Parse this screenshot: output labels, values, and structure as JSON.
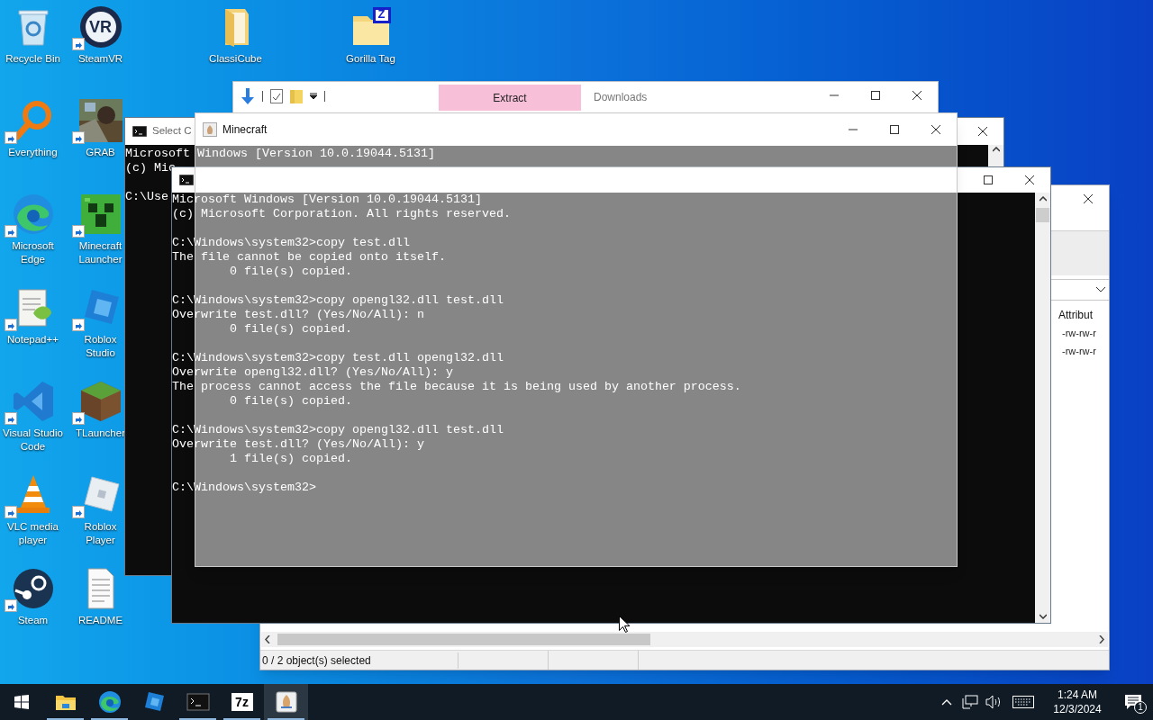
{
  "desktop_icons": [
    {
      "label": "Recycle Bin",
      "shortcut": false
    },
    {
      "label": "SteamVR",
      "shortcut": true,
      "logo_text": "VR"
    },
    {
      "label": "ClassiCube",
      "shortcut": false
    },
    {
      "label": "Gorilla Tag",
      "shortcut": false,
      "logo_text": "Z"
    },
    {
      "label": "Everything",
      "shortcut": true
    },
    {
      "label": "GRAB",
      "shortcut": true
    },
    {
      "label": "Microsoft Edge",
      "shortcut": true
    },
    {
      "label": "Minecraft Launcher",
      "shortcut": true
    },
    {
      "label": "Notepad++",
      "shortcut": true
    },
    {
      "label": "Roblox Studio",
      "shortcut": true
    },
    {
      "label": "Visual Studio Code",
      "shortcut": true
    },
    {
      "label": "TLauncher",
      "shortcut": true
    },
    {
      "label": "VLC media player",
      "shortcut": true
    },
    {
      "label": "Roblox Player",
      "shortcut": true
    },
    {
      "label": "Steam",
      "shortcut": true
    },
    {
      "label": "README",
      "shortcut": false
    }
  ],
  "file_manager": {
    "column_header": "Attribut",
    "rows": [
      "-rw-rw-r",
      "-rw-rw-r"
    ],
    "status": "0 / 2 object(s) selected"
  },
  "extract_window": {
    "tab": "Extract",
    "title": "Downloads"
  },
  "select_console": {
    "title": "Select C",
    "blocks": [
      [
        "Microsoft Windows [Version 10.0.19044.5131]",
        "(c) Mic"
      ],
      [
        "C:\\Use"
      ]
    ]
  },
  "console": {
    "blocks": [
      [
        "Microsoft Windows [Version 10.0.19044.5131]",
        "(c) Microsoft Corporation. All rights reserved."
      ],
      [
        "C:\\Windows\\system32>copy test.dll",
        "The file cannot be copied onto itself.",
        "        0 file(s) copied."
      ],
      [
        "C:\\Windows\\system32>copy opengl32.dll test.dll",
        "Overwrite test.dll? (Yes/No/All): n",
        "        0 file(s) copied."
      ],
      [
        "C:\\Windows\\system32>copy test.dll opengl32.dll",
        "Overwrite opengl32.dll? (Yes/No/All): y",
        "The process cannot access the file because it is being used by another process.",
        "        0 file(s) copied."
      ],
      [
        "C:\\Windows\\system32>copy opengl32.dll test.dll",
        "Overwrite test.dll? (Yes/No/All): y",
        "        1 file(s) copied."
      ],
      [
        "C:\\Windows\\system32>"
      ]
    ]
  },
  "minecraft": {
    "title": "Minecraft"
  },
  "taskbar": {
    "apps": [
      {
        "running": true,
        "selected": false
      },
      {
        "running": true,
        "selected": false
      },
      {
        "running": false,
        "selected": false
      },
      {
        "running": true,
        "selected": false
      },
      {
        "running": true,
        "selected": false,
        "logo_text": "7z"
      },
      {
        "running": true,
        "selected": true
      }
    ],
    "clock": {
      "time": "1:24 AM",
      "date": "12/3/2024"
    },
    "notifications": {
      "count": "1"
    }
  }
}
